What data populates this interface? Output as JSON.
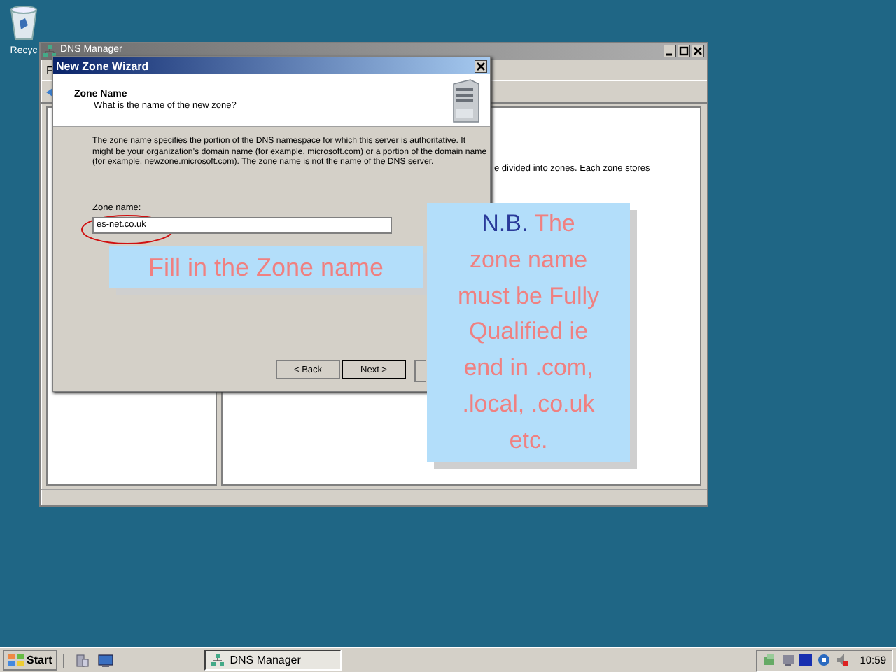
{
  "desktop": {
    "icons": [
      {
        "label": "Recyc"
      }
    ]
  },
  "background_window": {
    "title": "DNS Manager",
    "menu": [
      "F"
    ],
    "visible_text": "e divided into zones. Each zone stores"
  },
  "wizard": {
    "title": "New Zone Wizard",
    "heading": "Zone Name",
    "subheading": "What is the name of the new zone?",
    "description": "The zone name specifies the portion of the DNS namespace for which this server is authoritative. It might be your organization's domain name (for example, microsoft.com) or a portion of the domain name (for example, newzone.microsoft.com). The zone name is not the name of the DNS server.",
    "field": {
      "label": "Zone name:",
      "value": "es-net.co.uk"
    },
    "buttons": [
      {
        "label": "< Back",
        "selected": false
      },
      {
        "label": "Next >",
        "selected": true
      }
    ]
  },
  "annotations": [
    {
      "kind": "label",
      "text": "Fill in the Zone name"
    },
    {
      "kind": "note",
      "lead": "N.B.",
      "text": "The zone name must be Fully Qualified ie end in .com, .local, .co.uk etc."
    }
  ],
  "taskbar": {
    "start": "Start",
    "tasks": [
      {
        "label": "DNS Manager",
        "selected": true
      }
    ],
    "clock": "10:59"
  }
}
